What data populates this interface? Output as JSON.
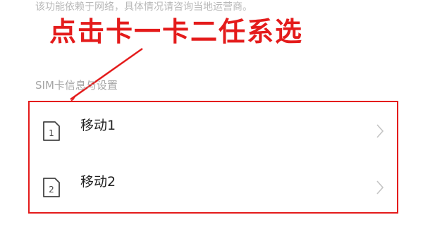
{
  "top_note": "该功能依赖于网络，具体情况请咨询当地运营商。",
  "callout": "点击卡一卡二任系选",
  "section_title": "SIM卡信息与设置",
  "sims": [
    {
      "label": "移动1",
      "icon_number": "1",
      "icon": "sim-card-icon"
    },
    {
      "label": "移动2",
      "icon_number": "2",
      "icon": "sim-card-icon"
    }
  ],
  "colors": {
    "accent": "#e41b1b",
    "muted_text": "#b8b8b8",
    "label": "#222222"
  }
}
